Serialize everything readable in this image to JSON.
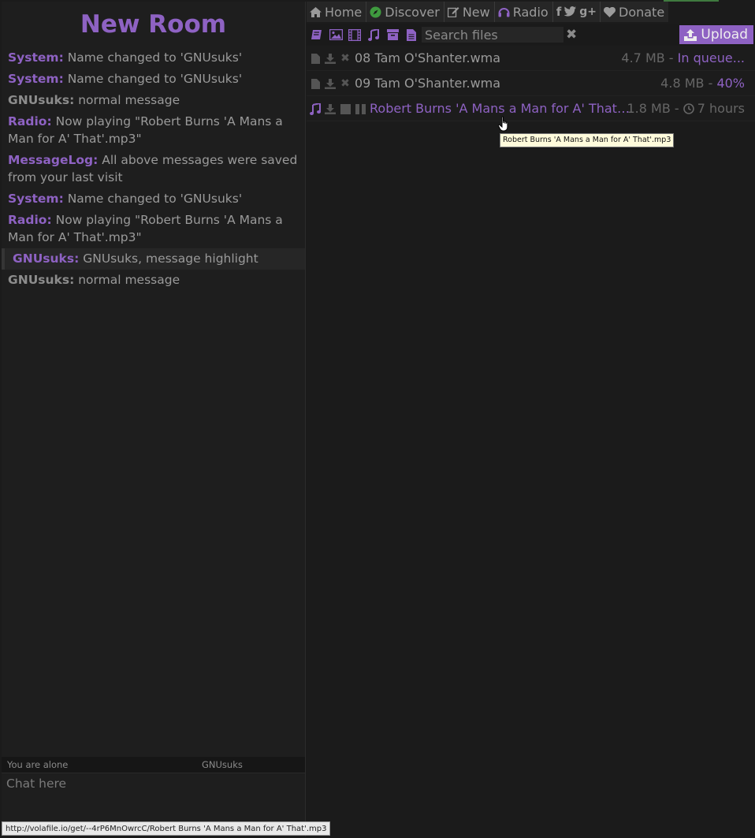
{
  "room": {
    "title": "New Room"
  },
  "chat": {
    "messages": [
      {
        "nick": "System:",
        "text": "Name changed to 'GNUsuks'"
      },
      {
        "nick": "System:",
        "text": "Name changed to 'GNUsuks'"
      },
      {
        "nick": "GNUsuks:",
        "text": "normal message"
      },
      {
        "nick": "Radio:",
        "text": "Now playing \"Robert Burns 'A Mans a Man for A' That'.mp3\""
      },
      {
        "nick": "MessageLog:",
        "text": "All above messages were saved from your last visit"
      },
      {
        "nick": "System:",
        "text": "Name changed to 'GNUsuks'"
      },
      {
        "nick": "Radio:",
        "text": "Now playing \"Robert Burns 'A Mans a Man for A' That'.mp3\""
      },
      {
        "nick": "GNUsuks:",
        "text": "GNUsuks, message highlight"
      },
      {
        "nick": "GNUsuks:",
        "text": "normal message"
      }
    ],
    "status_alone": "You are alone",
    "status_nick": "GNUsuks",
    "input_placeholder": "Chat here"
  },
  "status_bar_url": "http://volafile.io/get/--4rP6MnOwrcC/Robert Burns 'A Mans a Man for A' That'.mp3",
  "nav": {
    "home": "Home",
    "discover": "Discover",
    "new": "New",
    "radio": "Radio",
    "donate": "Donate"
  },
  "toolbar": {
    "search_placeholder": "Search files",
    "clear": "✖",
    "upload": "Upload"
  },
  "files": [
    {
      "name": "08 Tam O'Shanter.wma",
      "size": "4.7 MB",
      "sep": " - ",
      "status": "In queue..."
    },
    {
      "name": "09 Tam O'Shanter.wma",
      "size": "4.8 MB",
      "sep": " - ",
      "status": "40%"
    },
    {
      "name": "Robert Burns 'A Mans a Man for A' That'.mp3",
      "size": "1.8 MB",
      "sep": " - ",
      "status": "7 hours"
    }
  ],
  "tooltip": "Robert Burns 'A Mans a Man for A' That'.mp3",
  "colors": {
    "accent": "#8e62c3",
    "background": "#1b1b1b",
    "text": "#9a9a9a"
  }
}
